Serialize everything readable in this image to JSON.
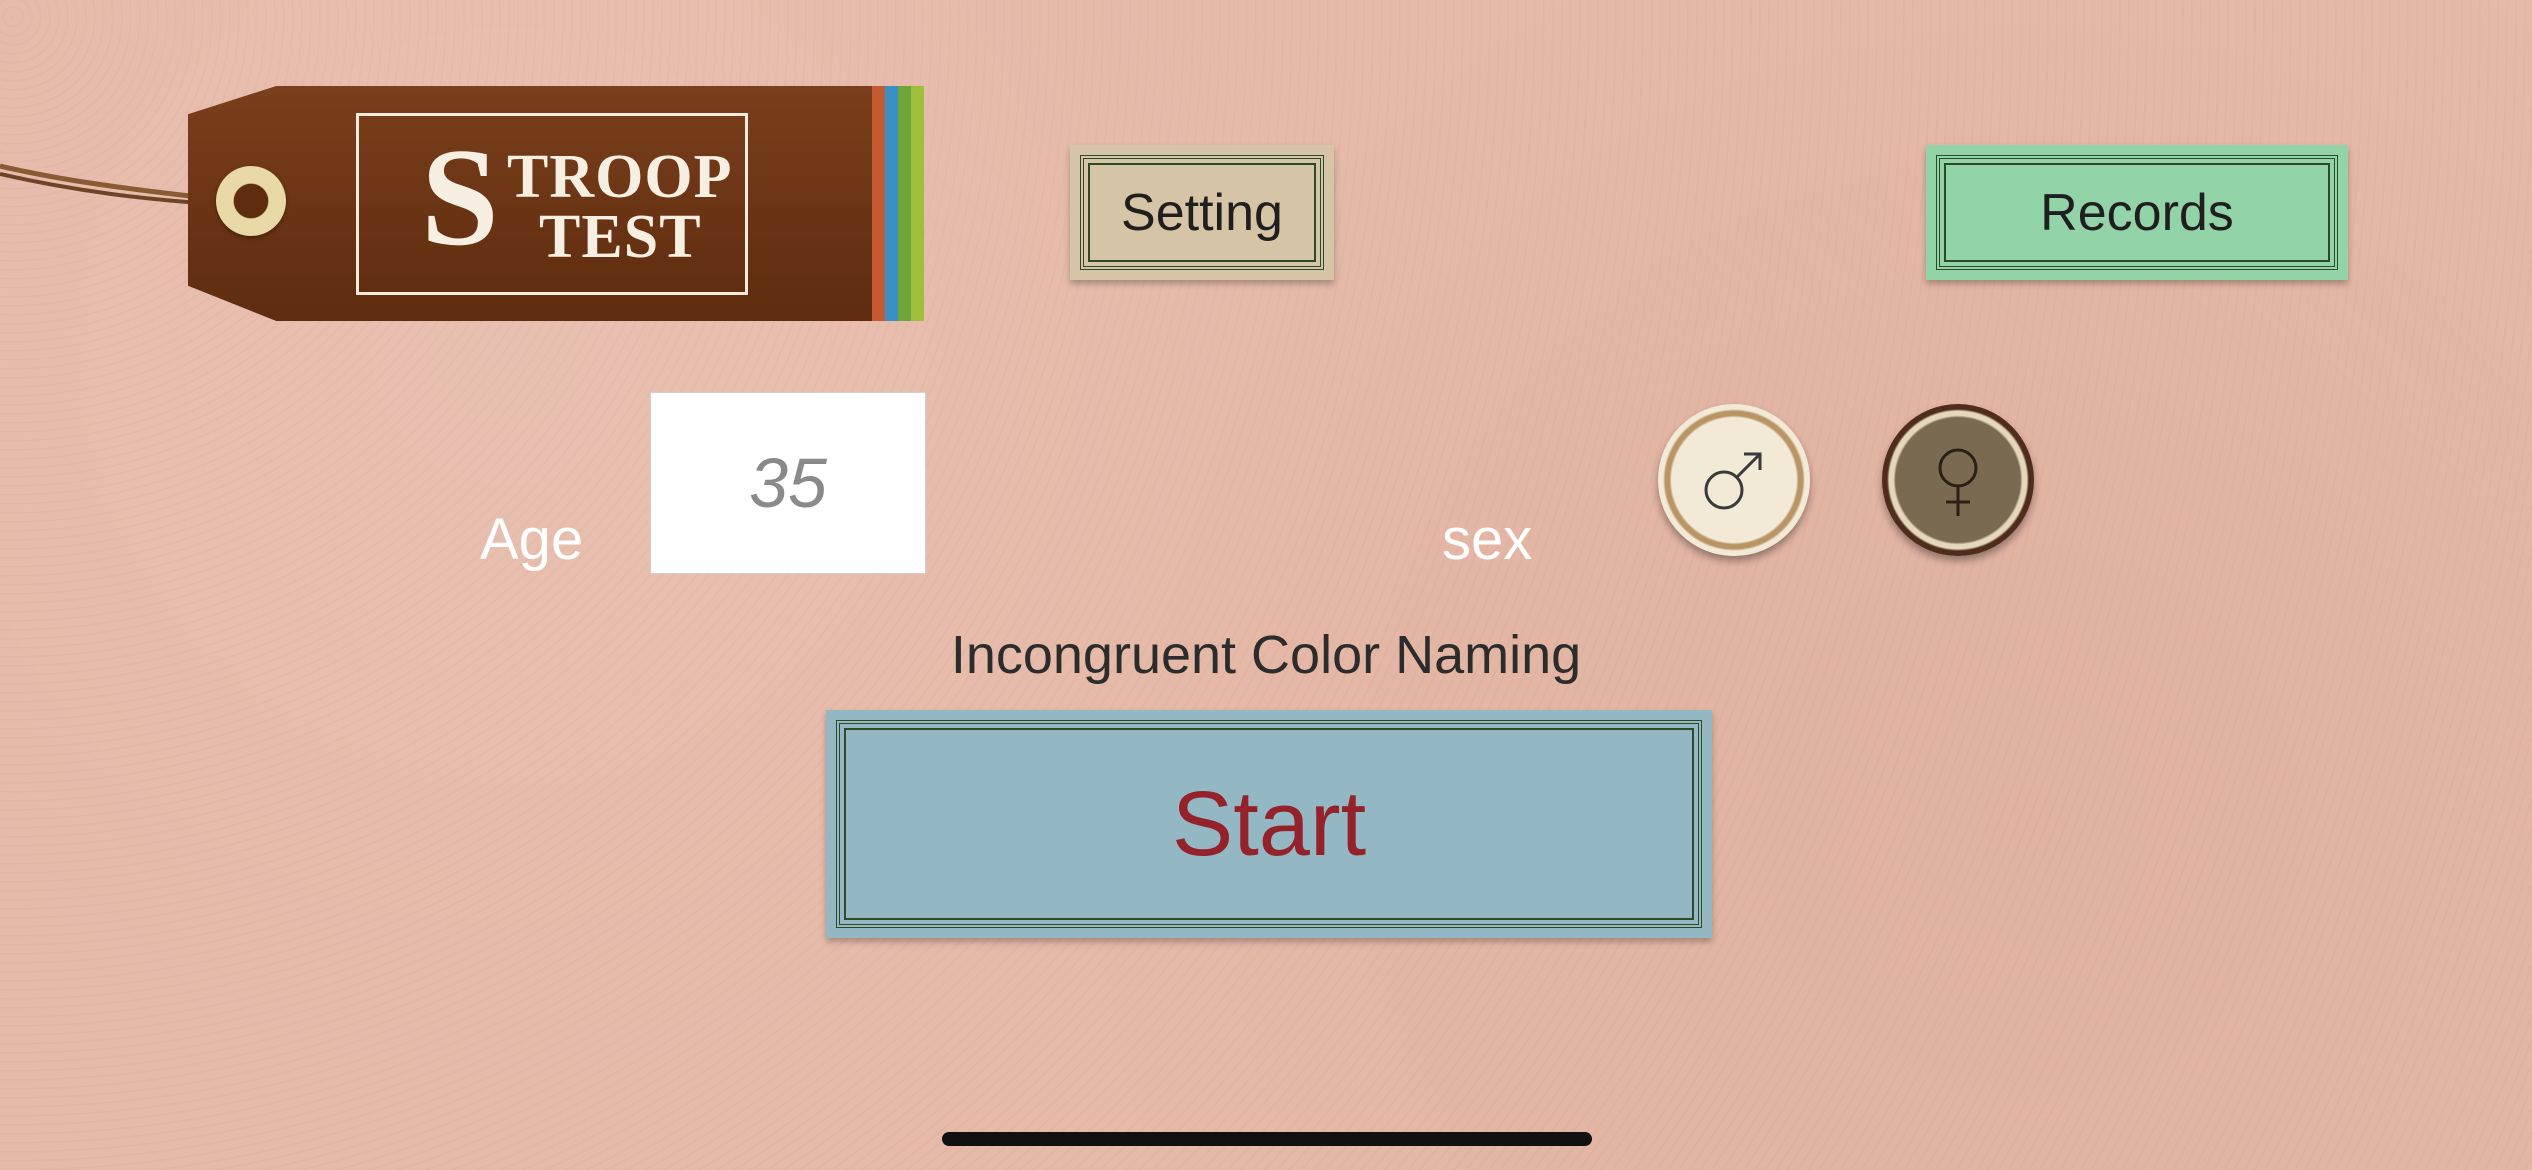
{
  "logo": {
    "initial": "S",
    "word1": "TROOP",
    "word2": "TEST"
  },
  "setting_button": {
    "label": "Setting"
  },
  "records_button": {
    "label": "Records"
  },
  "age": {
    "label": "Age",
    "value": "35"
  },
  "sex": {
    "label": "sex",
    "options": [
      {
        "icon": "male-symbol-icon"
      },
      {
        "icon": "female-symbol-icon"
      }
    ]
  },
  "test_mode": "Incongruent Color Naming",
  "start_button": {
    "label": "Start"
  },
  "colors": {
    "background": "#e6b9a8",
    "logo_tag": "#6a3414",
    "setting_button": "#d5c4a6",
    "records_button": "#92d4a7",
    "start_button": "#93b8c4",
    "start_text": "#94222a"
  }
}
